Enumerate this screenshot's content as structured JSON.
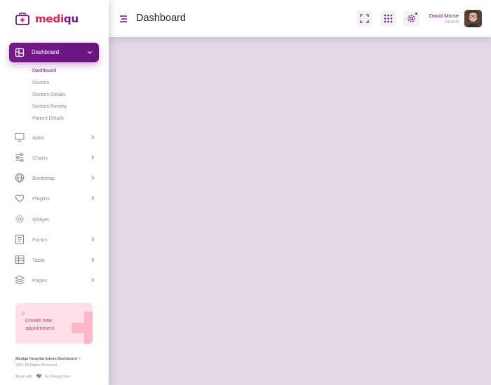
{
  "brand": {
    "name_part1": "medi",
    "name_part2": "qu",
    "logo_icon": "medical-box-icon"
  },
  "sidebar": {
    "active_menu": {
      "label": "Dashboard",
      "icon": "dashboard-icon"
    },
    "submenu": [
      "Dashboard",
      "Doctors",
      "Doctors Details",
      "Doctors Review",
      "Patient Details"
    ],
    "items": [
      {
        "label": "Apps",
        "icon": "monitor-icon",
        "has_children": true
      },
      {
        "label": "Charts",
        "icon": "sliders-icon",
        "has_children": true
      },
      {
        "label": "Bootstrap",
        "icon": "globe-icon",
        "has_children": true
      },
      {
        "label": "Plugins",
        "icon": "heart-icon",
        "has_children": true
      },
      {
        "label": "Widget",
        "icon": "gear-icon",
        "has_children": false
      },
      {
        "label": "Forms",
        "icon": "form-icon",
        "has_children": true
      },
      {
        "label": "Table",
        "icon": "table-icon",
        "has_children": true
      },
      {
        "label": "Pages",
        "icon": "layers-icon",
        "has_children": true
      }
    ],
    "promo": {
      "text": "Create new appointment"
    },
    "footer": {
      "title": "Mediqu Hospital Admin Dashboard",
      "copyright_symbol": "©",
      "rights": "2021 All Rights Reserved",
      "made_with": "Made with",
      "by": "By DexignZone"
    }
  },
  "header": {
    "title": "Dashboard",
    "user_name": "David Morse",
    "user_role": "ADMIN"
  },
  "colors": {
    "accent": "#75198c",
    "brand_red": "#e31e4f",
    "content_bg": "#e2d8e6"
  }
}
